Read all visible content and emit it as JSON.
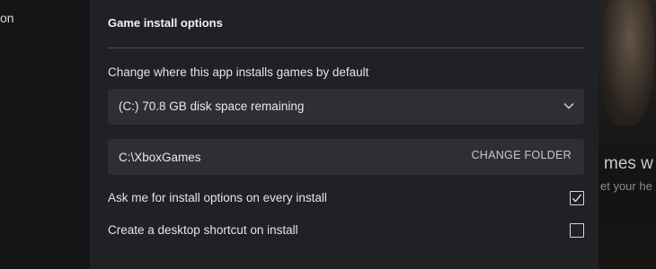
{
  "sidebar": {
    "partial_text": "on"
  },
  "background": {
    "heading_fragment": "mes w",
    "subtext_fragment": "et your he"
  },
  "dialog": {
    "section_title": "Game install options",
    "location_label": "Change where this app installs games by default",
    "drive_select": {
      "selected": "(C:) 70.8 GB disk space remaining"
    },
    "folder": {
      "path": "C:\\XboxGames",
      "change_button": "CHANGE FOLDER"
    },
    "options": [
      {
        "label": "Ask me for install options on every install",
        "checked": true
      },
      {
        "label": "Create a desktop shortcut on install",
        "checked": false
      }
    ]
  },
  "icons": {
    "dropdown": "chevron-down-icon",
    "check": "checkmark-icon"
  }
}
